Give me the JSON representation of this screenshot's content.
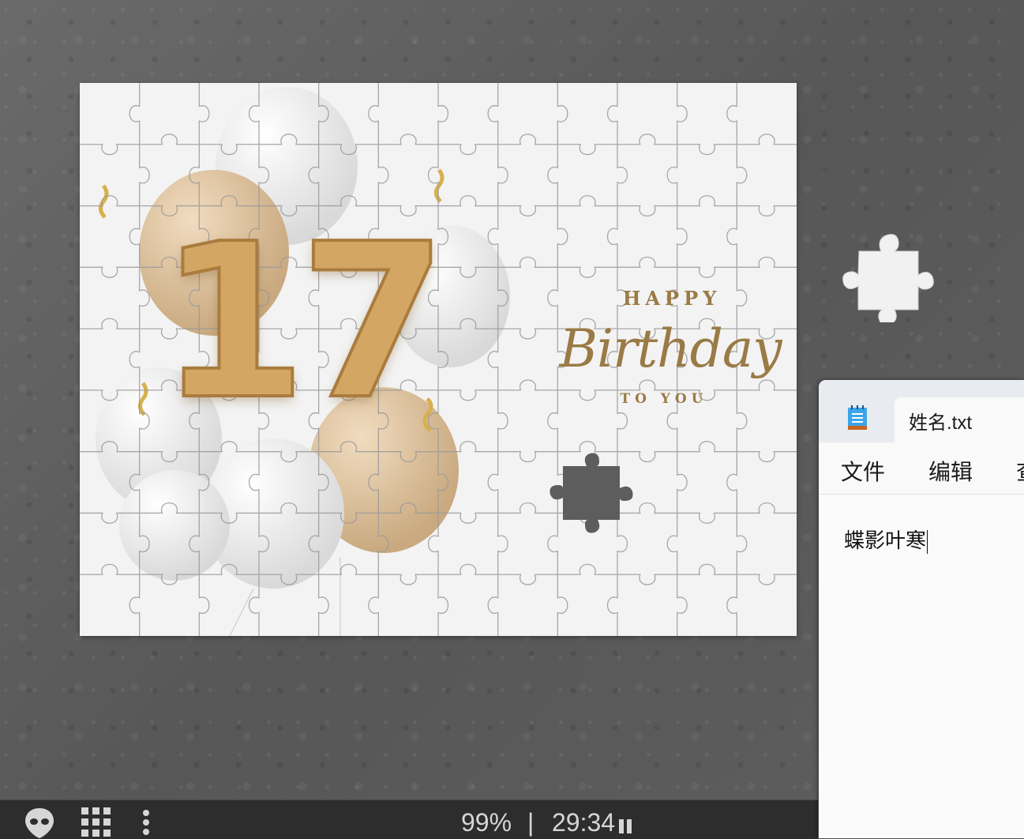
{
  "puzzle": {
    "image_text": {
      "number": "17",
      "happy": "HAPPY",
      "birthday": "Birthday",
      "to_you": "TO YOU"
    },
    "colors": {
      "gold": "#c9a063",
      "table": "#5f5f5f",
      "board": "#f3f3f3"
    }
  },
  "toolbar": {
    "zoom": "99%",
    "separator": "|",
    "timer": "29:34",
    "icons": [
      "alien-head-icon",
      "grid-pieces-icon",
      "more-vertical-icon",
      "pause-icon"
    ]
  },
  "notepad": {
    "tab_title": "姓名.txt",
    "menu": [
      "文件",
      "编辑",
      "查"
    ],
    "content": "蝶影叶寒"
  }
}
